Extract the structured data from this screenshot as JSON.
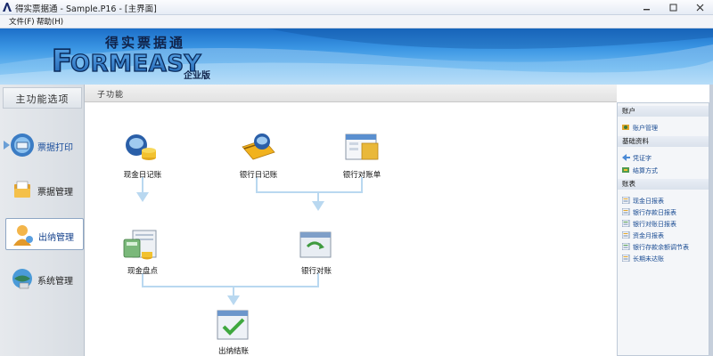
{
  "window": {
    "title": "得实票据通 - Sample.P16 - [主界面]",
    "buttons": [
      "minimize",
      "maximize",
      "close"
    ]
  },
  "menu": {
    "items": [
      "文件(F)",
      "帮助(H)"
    ]
  },
  "banner": {
    "chinese_title": "得实票据通",
    "logo": "FORMEASY",
    "edition": "企业版"
  },
  "leftnav": {
    "header": "主功能选项",
    "items": [
      {
        "label": "票据打印",
        "icon": "printer-icon",
        "state": "highlight"
      },
      {
        "label": "票据管理",
        "icon": "folder-icon",
        "state": "normal"
      },
      {
        "label": "出纳管理",
        "icon": "user-icon",
        "state": "active"
      },
      {
        "label": "系统管理",
        "icon": "system-icon",
        "state": "normal"
      }
    ]
  },
  "content": {
    "header": "子功能",
    "nodes": [
      {
        "label": "现金日记账",
        "icon": "cash-journal-icon"
      },
      {
        "label": "银行日记账",
        "icon": "bank-journal-icon"
      },
      {
        "label": "银行对账单",
        "icon": "bank-statement-icon"
      },
      {
        "label": "现金盘点",
        "icon": "cash-count-icon"
      },
      {
        "label": "银行对账",
        "icon": "bank-reconcile-icon"
      },
      {
        "label": "出纳结账",
        "icon": "cashier-close-icon"
      }
    ]
  },
  "rightpanel": {
    "sections": [
      {
        "title": "账户",
        "items": [
          {
            "label": "账户管理",
            "icon": "account-icon"
          }
        ]
      },
      {
        "title": "基础资料",
        "items": [
          {
            "label": "凭证字",
            "icon": "voucher-icon"
          },
          {
            "label": "结算方式",
            "icon": "settlement-icon"
          }
        ]
      },
      {
        "title": "账表",
        "items": [
          {
            "label": "现金日报表",
            "icon": "report-icon"
          },
          {
            "label": "银行存款日报表",
            "icon": "report-icon"
          },
          {
            "label": "银行对账日报表",
            "icon": "report-icon"
          },
          {
            "label": "资金月报表",
            "icon": "report-icon"
          },
          {
            "label": "银行存款余额调节表",
            "icon": "report-icon"
          },
          {
            "label": "长期未达账",
            "icon": "report-icon"
          }
        ]
      }
    ]
  },
  "colors": {
    "banner_dark": "#1c6fc9",
    "banner_light": "#9fd2f6",
    "flow_line": "#b9d8f0",
    "link": "#1a4c93"
  }
}
